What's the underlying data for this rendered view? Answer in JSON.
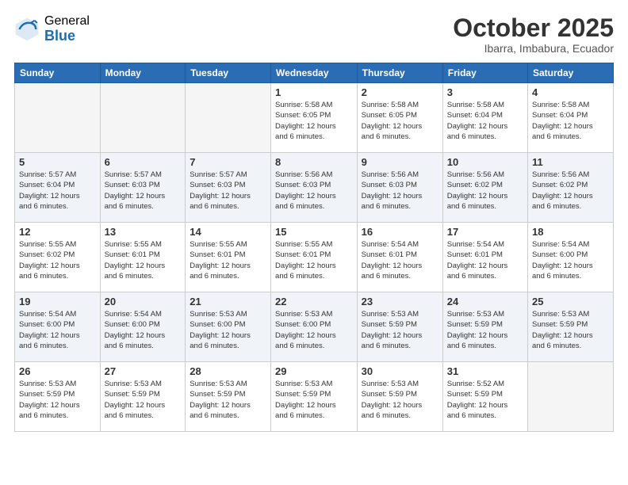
{
  "logo": {
    "general": "General",
    "blue": "Blue"
  },
  "title": "October 2025",
  "subtitle": "Ibarra, Imbabura, Ecuador",
  "days_header": [
    "Sunday",
    "Monday",
    "Tuesday",
    "Wednesday",
    "Thursday",
    "Friday",
    "Saturday"
  ],
  "weeks": [
    {
      "days": [
        {
          "num": "",
          "info": ""
        },
        {
          "num": "",
          "info": ""
        },
        {
          "num": "",
          "info": ""
        },
        {
          "num": "1",
          "info": "Sunrise: 5:58 AM\nSunset: 6:05 PM\nDaylight: 12 hours\nand 6 minutes."
        },
        {
          "num": "2",
          "info": "Sunrise: 5:58 AM\nSunset: 6:05 PM\nDaylight: 12 hours\nand 6 minutes."
        },
        {
          "num": "3",
          "info": "Sunrise: 5:58 AM\nSunset: 6:04 PM\nDaylight: 12 hours\nand 6 minutes."
        },
        {
          "num": "4",
          "info": "Sunrise: 5:58 AM\nSunset: 6:04 PM\nDaylight: 12 hours\nand 6 minutes."
        }
      ]
    },
    {
      "days": [
        {
          "num": "5",
          "info": "Sunrise: 5:57 AM\nSunset: 6:04 PM\nDaylight: 12 hours\nand 6 minutes."
        },
        {
          "num": "6",
          "info": "Sunrise: 5:57 AM\nSunset: 6:03 PM\nDaylight: 12 hours\nand 6 minutes."
        },
        {
          "num": "7",
          "info": "Sunrise: 5:57 AM\nSunset: 6:03 PM\nDaylight: 12 hours\nand 6 minutes."
        },
        {
          "num": "8",
          "info": "Sunrise: 5:56 AM\nSunset: 6:03 PM\nDaylight: 12 hours\nand 6 minutes."
        },
        {
          "num": "9",
          "info": "Sunrise: 5:56 AM\nSunset: 6:03 PM\nDaylight: 12 hours\nand 6 minutes."
        },
        {
          "num": "10",
          "info": "Sunrise: 5:56 AM\nSunset: 6:02 PM\nDaylight: 12 hours\nand 6 minutes."
        },
        {
          "num": "11",
          "info": "Sunrise: 5:56 AM\nSunset: 6:02 PM\nDaylight: 12 hours\nand 6 minutes."
        }
      ]
    },
    {
      "days": [
        {
          "num": "12",
          "info": "Sunrise: 5:55 AM\nSunset: 6:02 PM\nDaylight: 12 hours\nand 6 minutes."
        },
        {
          "num": "13",
          "info": "Sunrise: 5:55 AM\nSunset: 6:01 PM\nDaylight: 12 hours\nand 6 minutes."
        },
        {
          "num": "14",
          "info": "Sunrise: 5:55 AM\nSunset: 6:01 PM\nDaylight: 12 hours\nand 6 minutes."
        },
        {
          "num": "15",
          "info": "Sunrise: 5:55 AM\nSunset: 6:01 PM\nDaylight: 12 hours\nand 6 minutes."
        },
        {
          "num": "16",
          "info": "Sunrise: 5:54 AM\nSunset: 6:01 PM\nDaylight: 12 hours\nand 6 minutes."
        },
        {
          "num": "17",
          "info": "Sunrise: 5:54 AM\nSunset: 6:01 PM\nDaylight: 12 hours\nand 6 minutes."
        },
        {
          "num": "18",
          "info": "Sunrise: 5:54 AM\nSunset: 6:00 PM\nDaylight: 12 hours\nand 6 minutes."
        }
      ]
    },
    {
      "days": [
        {
          "num": "19",
          "info": "Sunrise: 5:54 AM\nSunset: 6:00 PM\nDaylight: 12 hours\nand 6 minutes."
        },
        {
          "num": "20",
          "info": "Sunrise: 5:54 AM\nSunset: 6:00 PM\nDaylight: 12 hours\nand 6 minutes."
        },
        {
          "num": "21",
          "info": "Sunrise: 5:53 AM\nSunset: 6:00 PM\nDaylight: 12 hours\nand 6 minutes."
        },
        {
          "num": "22",
          "info": "Sunrise: 5:53 AM\nSunset: 6:00 PM\nDaylight: 12 hours\nand 6 minutes."
        },
        {
          "num": "23",
          "info": "Sunrise: 5:53 AM\nSunset: 5:59 PM\nDaylight: 12 hours\nand 6 minutes."
        },
        {
          "num": "24",
          "info": "Sunrise: 5:53 AM\nSunset: 5:59 PM\nDaylight: 12 hours\nand 6 minutes."
        },
        {
          "num": "25",
          "info": "Sunrise: 5:53 AM\nSunset: 5:59 PM\nDaylight: 12 hours\nand 6 minutes."
        }
      ]
    },
    {
      "days": [
        {
          "num": "26",
          "info": "Sunrise: 5:53 AM\nSunset: 5:59 PM\nDaylight: 12 hours\nand 6 minutes."
        },
        {
          "num": "27",
          "info": "Sunrise: 5:53 AM\nSunset: 5:59 PM\nDaylight: 12 hours\nand 6 minutes."
        },
        {
          "num": "28",
          "info": "Sunrise: 5:53 AM\nSunset: 5:59 PM\nDaylight: 12 hours\nand 6 minutes."
        },
        {
          "num": "29",
          "info": "Sunrise: 5:53 AM\nSunset: 5:59 PM\nDaylight: 12 hours\nand 6 minutes."
        },
        {
          "num": "30",
          "info": "Sunrise: 5:53 AM\nSunset: 5:59 PM\nDaylight: 12 hours\nand 6 minutes."
        },
        {
          "num": "31",
          "info": "Sunrise: 5:52 AM\nSunset: 5:59 PM\nDaylight: 12 hours\nand 6 minutes."
        },
        {
          "num": "",
          "info": ""
        }
      ]
    }
  ]
}
